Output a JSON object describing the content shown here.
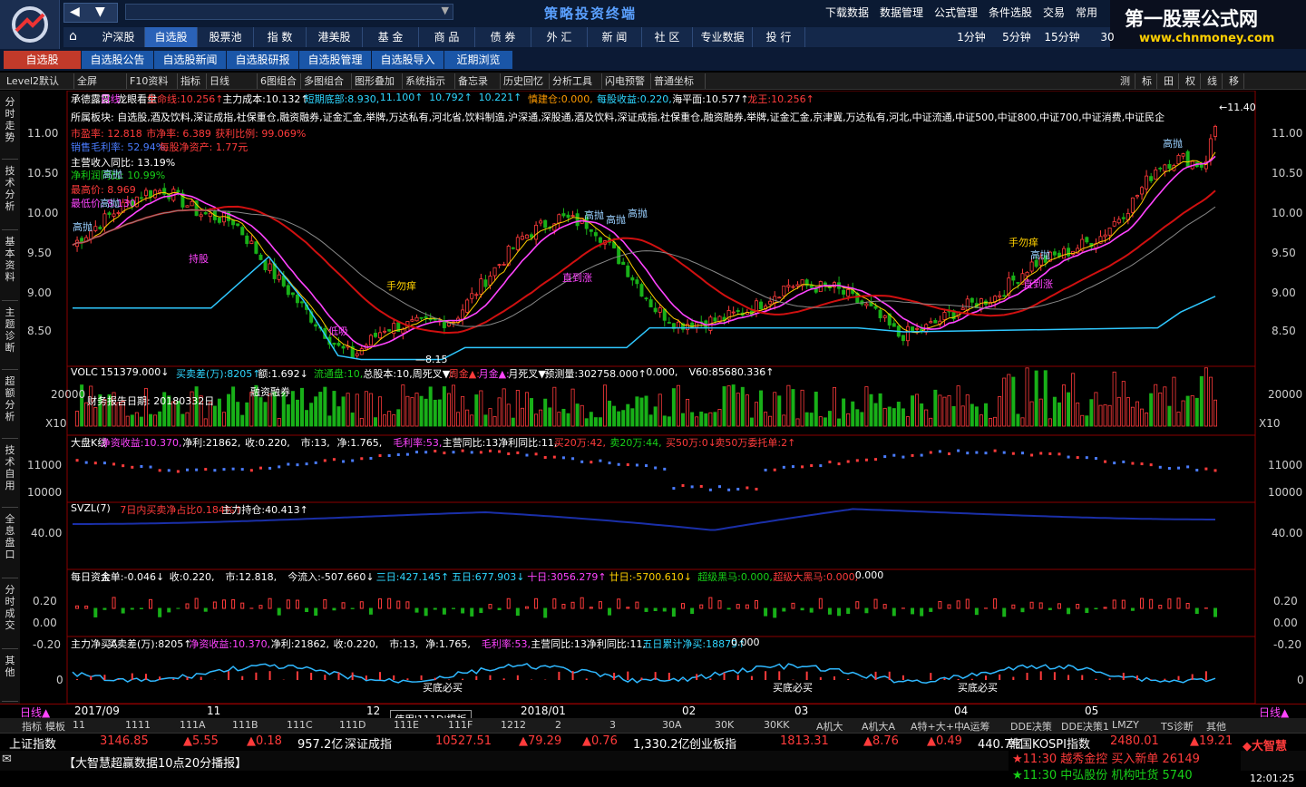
{
  "window": {
    "app_title": "策略投资终端",
    "top_menu": [
      "下载数据",
      "数据管理",
      "公式管理",
      "条件选股",
      "交易",
      "常用"
    ],
    "brand_line1": "第一股票公式网",
    "brand_line2": "www.chnmoney.com"
  },
  "nav": {
    "tabs": [
      "沪深股",
      "自选股",
      "股票池",
      "指 数",
      "港美股",
      "基 金",
      "商 品",
      "债 券",
      "外 汇",
      "新 闻",
      "社 区",
      "专业数据",
      "投 行"
    ],
    "active": "自选股",
    "periods": [
      "1分钟",
      "5分钟",
      "15分钟",
      "30"
    ]
  },
  "subnav": {
    "tabs": [
      "自选股",
      "自选股公告",
      "自选股新闻",
      "自选股研报",
      "自选股管理",
      "自选股导入",
      "近期浏览"
    ],
    "active": "自选股"
  },
  "toolbar": {
    "items": [
      "Level2默认",
      "全屏",
      "F10资料",
      "指标",
      "日线",
      "6图组合",
      "多图组合",
      "图形叠加",
      "系统指示",
      "备忘录",
      "历史回忆",
      "分析工具",
      "闪电预警",
      "普通坐标"
    ],
    "right": [
      "测",
      "标",
      "田",
      "权",
      "线",
      "移"
    ]
  },
  "left_tabs": [
    "分时走势",
    "技术分析",
    "基本资料",
    "主题诊断",
    "超额分析",
    "技术自用",
    "全息盘口",
    "分时成交",
    "其他"
  ],
  "main": {
    "stock": "承德露露",
    "period": "日线",
    "mode": "龙眼看盘",
    "line1": [
      {
        "k": "生命线:",
        "v": "10.256↑",
        "c": "red"
      },
      {
        "k": "主力成本:",
        "v": "10.132↑",
        "c": "white"
      },
      {
        "k": "短期底部:",
        "v": "8.930,",
        "c": "cyan"
      },
      {
        "k": "",
        "v": "11.100↑",
        "c": "cyan"
      },
      {
        "k": "",
        "v": "10.792↑",
        "c": "cyan"
      },
      {
        "k": "",
        "v": "10.221↑",
        "c": "cyan"
      },
      {
        "k": "慎建仓:",
        "v": "0.000,",
        "c": "orange"
      },
      {
        "k": "每股收益:",
        "v": "0.220,",
        "c": "cyan"
      },
      {
        "k": "海平面:",
        "v": "10.577↑",
        "c": "white"
      },
      {
        "k": "龙王:",
        "v": "10.256↑",
        "c": "red"
      }
    ],
    "sector": "所属板块: 自选股,酒及饮料,深证成指,社保重仓,融资融券,证金汇金,举牌,万达私有,河北省,饮料制造,沪深通,深股通,酒及饮料,深证成指,社保重仓,融资融券,举牌,证金汇金,京津冀,万达私有,河北,中证流通,中证500,中证800,中证700,中证消费,中证民企",
    "pe": "市盈率: 12.818",
    "pb": "市净率: 6.389",
    "profit_ratio": "获利比例: 99.069%",
    "gross_margin": "销售毛利率: 52.94%",
    "nav_ps": "每股净资产: 1.77元",
    "rev_yoy": "主营收入同比: 13.19%",
    "profit_yoy": "净利润同比: 10.99%",
    "high": "最高价: 8.969",
    "low": "最低价: 8.130",
    "yaxis": [
      "11.00",
      "10.50",
      "10.00",
      "9.50",
      "9.00",
      "8.50"
    ],
    "annotations": [
      "高抛",
      "持股",
      "手勿痒",
      "低吸",
      "高抛",
      "高抛",
      "高抛",
      "直到涨",
      "手勿痒",
      "高抛",
      "直到涨",
      "高抛",
      "高抛",
      "高抛"
    ],
    "low_mark": "8.15",
    "high_mark": "11.40"
  },
  "vol": {
    "label": "VOLC",
    "v": "151379.000↓",
    "t1": "买卖差(万):",
    "t1v": "8205↑",
    "t2": "额:",
    "t2v": "1.692↓",
    "t3": "流通盘:",
    "t3v": "10,",
    "t4": "总股本:",
    "t4v": "10,",
    "t5": "周死叉▼:",
    "t6": "周金▲:",
    "t7": "月金▲:",
    "t8": "月死叉▼:",
    "t9": "预测量:",
    "t9v": "302758.000↑",
    "t10": "0.000,",
    "t11": "V60:",
    "t11v": "85680.336↑",
    "report": "财务报告日期: 20180332日",
    "margin": "融资融券",
    "yaxis": "20000",
    "x10": "X10"
  },
  "k2": {
    "label": "大盘K线",
    "a": "净资收益:",
    "av": "10.370,",
    "b": "净利:",
    "bv": "21862,",
    "c": "收:",
    "cv": "0.220,",
    "d": "市:",
    "dv": "13,",
    "e": "净:",
    "ev": "1.765,",
    "f": "毛利率:",
    "fv": "53,",
    "g": "主营同比:",
    "gv": "13,",
    "h": "净利同比:",
    "hv": "11,",
    "i": "买20万:",
    "iv": "42,",
    "j": "卖20万:",
    "jv": "44,",
    "k": "买50万:",
    "kv": "0↓",
    "l": "卖50万委托单:",
    "lv": "2↑",
    "yaxis": [
      "11000",
      "10000"
    ]
  },
  "svzl": {
    "label": "SVZL(7)",
    "a": "7日内买卖净占比",
    "av": "0.184%↑",
    "b": "主力持仓:",
    "bv": "40.413↑",
    "yaxis": "40.00"
  },
  "fund": {
    "label": "每日资金",
    "a": "大单:",
    "av": "-0.046↓",
    "b": "收:",
    "bv": "0.220,",
    "c": "市:",
    "cv": "12.818,",
    "d": "今流入:",
    "dv": "-507.660↓",
    "e": "三日:",
    "ev": "427.145↑",
    "f": "五日:",
    "fv": "677.903↓",
    "g": "十日:",
    "gv": "3056.279↑",
    "h": "廿日:",
    "hv": "-5700.610↓",
    "i": "超级黑马:",
    "iv": "0.000,",
    "j": "超级大黑马:",
    "jv": "0.000,",
    "k": "0.000",
    "yaxis": [
      "0.20",
      "0.00",
      "-0.20"
    ]
  },
  "mainnet": {
    "label": "主力净买A",
    "a": "买卖差(万):",
    "av": "8205↑",
    "b": "净资收益:",
    "bv": "10.370,",
    "c": "净利:",
    "cv": "21862,",
    "d": "收:",
    "dv": "0.220,",
    "e": "市:",
    "ev": "13,",
    "f": "净:",
    "fv": "1.765,",
    "g": "毛利率:",
    "gv": "53,",
    "h": "主营同比:",
    "hv": "13,",
    "i": "净利同比:",
    "iv": "11,",
    "j": "五日累计净买:",
    "jv": "18879↑",
    "k": "0.000",
    "annot": "买底必买",
    "yaxis": "0"
  },
  "dates": {
    "left": "日线▲",
    "labels": [
      "2017/09",
      "11",
      "12",
      "2018/01",
      "02",
      "03",
      "04",
      "05"
    ],
    "right": "日线▲"
  },
  "indicator_tabs": [
    "指标",
    "模板",
    "11",
    "1111",
    "111A",
    "111B",
    "111C",
    "111D",
    "111E",
    "111F",
    "1212",
    "2",
    "3",
    "30A",
    "30K",
    "30KK",
    "A机大",
    "A机大A",
    "A特+大+中",
    "A运筹",
    "DDE决策",
    "DDE决策1",
    "LMZY",
    "TS诊断",
    "其他"
  ],
  "tooltip": "使用'111D'模板",
  "ticker": [
    {
      "name": "上证指数",
      "val": "3146.85",
      "chg": "▲5.55",
      "pct": "▲0.18",
      "amt": "957.2亿"
    },
    {
      "name": "深证成指",
      "val": "10527.51",
      "chg": "▲79.29",
      "pct": "▲0.76",
      "amt": "1,330.2亿"
    },
    {
      "name": "创业板指",
      "val": "1813.31",
      "chg": "▲8.76",
      "pct": "▲0.49",
      "amt": "440.7亿"
    },
    {
      "name": "韩国KOSPI指数",
      "val": "2480.01",
      "chg": "▲19.21"
    }
  ],
  "news": "【大智慧超赢数据10点20分播报】",
  "alerts": [
    {
      "time": "★11:30",
      "text": "越秀金控 买入新单 26149"
    },
    {
      "time": "★11:30",
      "text": "中弘股份 机构吐货 5740"
    }
  ],
  "clock": "12:01:25"
}
